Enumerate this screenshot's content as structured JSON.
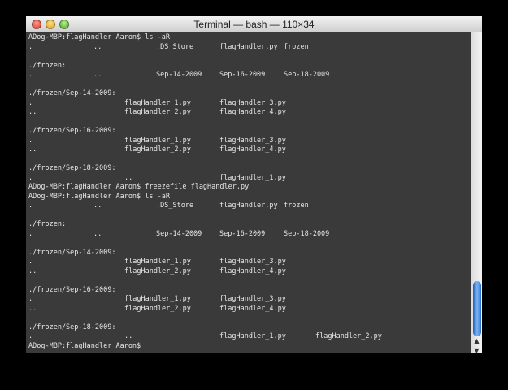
{
  "window": {
    "title": "Terminal — bash — 110×34"
  },
  "colors": {
    "background": "#3a3a3a",
    "text": "#e6e6e6",
    "scroll_thumb": "#2a6fd2"
  },
  "terminal_lines": [
    {
      "cols": {
        "c1": "ADog-MBP:flagHandler Aaron$ ls -aR"
      }
    },
    {
      "cols": {
        "c1": ".",
        "c2": "..",
        "c4": ".DS_Store",
        "c5": "flagHandler.py",
        "c6": "frozen"
      }
    },
    {
      "cols": {}
    },
    {
      "cols": {
        "c1": "./frozen:"
      }
    },
    {
      "cols": {
        "c1": ".",
        "c2": "..",
        "c4": "Sep-14-2009",
        "c5": "Sep-16-2009",
        "c6": "Sep-18-2009"
      }
    },
    {
      "cols": {}
    },
    {
      "cols": {
        "c1": "./frozen/Sep-14-2009:"
      }
    },
    {
      "cols": {
        "c1": ".",
        "c3": "flagHandler_1.py",
        "c5": "flagHandler_3.py"
      }
    },
    {
      "cols": {
        "c1": "..",
        "c3": "flagHandler_2.py",
        "c5": "flagHandler_4.py"
      }
    },
    {
      "cols": {}
    },
    {
      "cols": {
        "c1": "./frozen/Sep-16-2009:"
      }
    },
    {
      "cols": {
        "c1": ".",
        "c3": "flagHandler_1.py",
        "c5": "flagHandler_3.py"
      }
    },
    {
      "cols": {
        "c1": "..",
        "c3": "flagHandler_2.py",
        "c5": "flagHandler_4.py"
      }
    },
    {
      "cols": {}
    },
    {
      "cols": {
        "c1": "./frozen/Sep-18-2009:"
      }
    },
    {
      "cols": {
        "c1": ".",
        "c3": "..",
        "c5": "flagHandler_1.py"
      }
    },
    {
      "cols": {
        "c1": "ADog-MBP:flagHandler Aaron$ freezefile flagHandler.py"
      }
    },
    {
      "cols": {
        "c1": "ADog-MBP:flagHandler Aaron$ ls -aR"
      }
    },
    {
      "cols": {
        "c1": ".",
        "c2": "..",
        "c4": ".DS_Store",
        "c5": "flagHandler.py",
        "c6": "frozen"
      }
    },
    {
      "cols": {}
    },
    {
      "cols": {
        "c1": "./frozen:"
      }
    },
    {
      "cols": {
        "c1": ".",
        "c2": "..",
        "c4": "Sep-14-2009",
        "c5": "Sep-16-2009",
        "c6": "Sep-18-2009"
      }
    },
    {
      "cols": {}
    },
    {
      "cols": {
        "c1": "./frozen/Sep-14-2009:"
      }
    },
    {
      "cols": {
        "c1": ".",
        "c3": "flagHandler_1.py",
        "c5": "flagHandler_3.py"
      }
    },
    {
      "cols": {
        "c1": "..",
        "c3": "flagHandler_2.py",
        "c5": "flagHandler_4.py"
      }
    },
    {
      "cols": {}
    },
    {
      "cols": {
        "c1": "./frozen/Sep-16-2009:"
      }
    },
    {
      "cols": {
        "c1": ".",
        "c3": "flagHandler_1.py",
        "c5": "flagHandler_3.py"
      }
    },
    {
      "cols": {
        "c1": "..",
        "c3": "flagHandler_2.py",
        "c5": "flagHandler_4.py"
      }
    },
    {
      "cols": {}
    },
    {
      "cols": {
        "c1": "./frozen/Sep-18-2009:"
      }
    },
    {
      "cols": {
        "c1": ".",
        "c3": "..",
        "c5": "flagHandler_1.py",
        "c7": "flagHandler_2.py"
      }
    },
    {
      "cols": {
        "c1": "ADog-MBP:flagHandler Aaron$"
      }
    }
  ],
  "scrollbar": {
    "up_icon": "▲",
    "down_icon": "▼"
  }
}
